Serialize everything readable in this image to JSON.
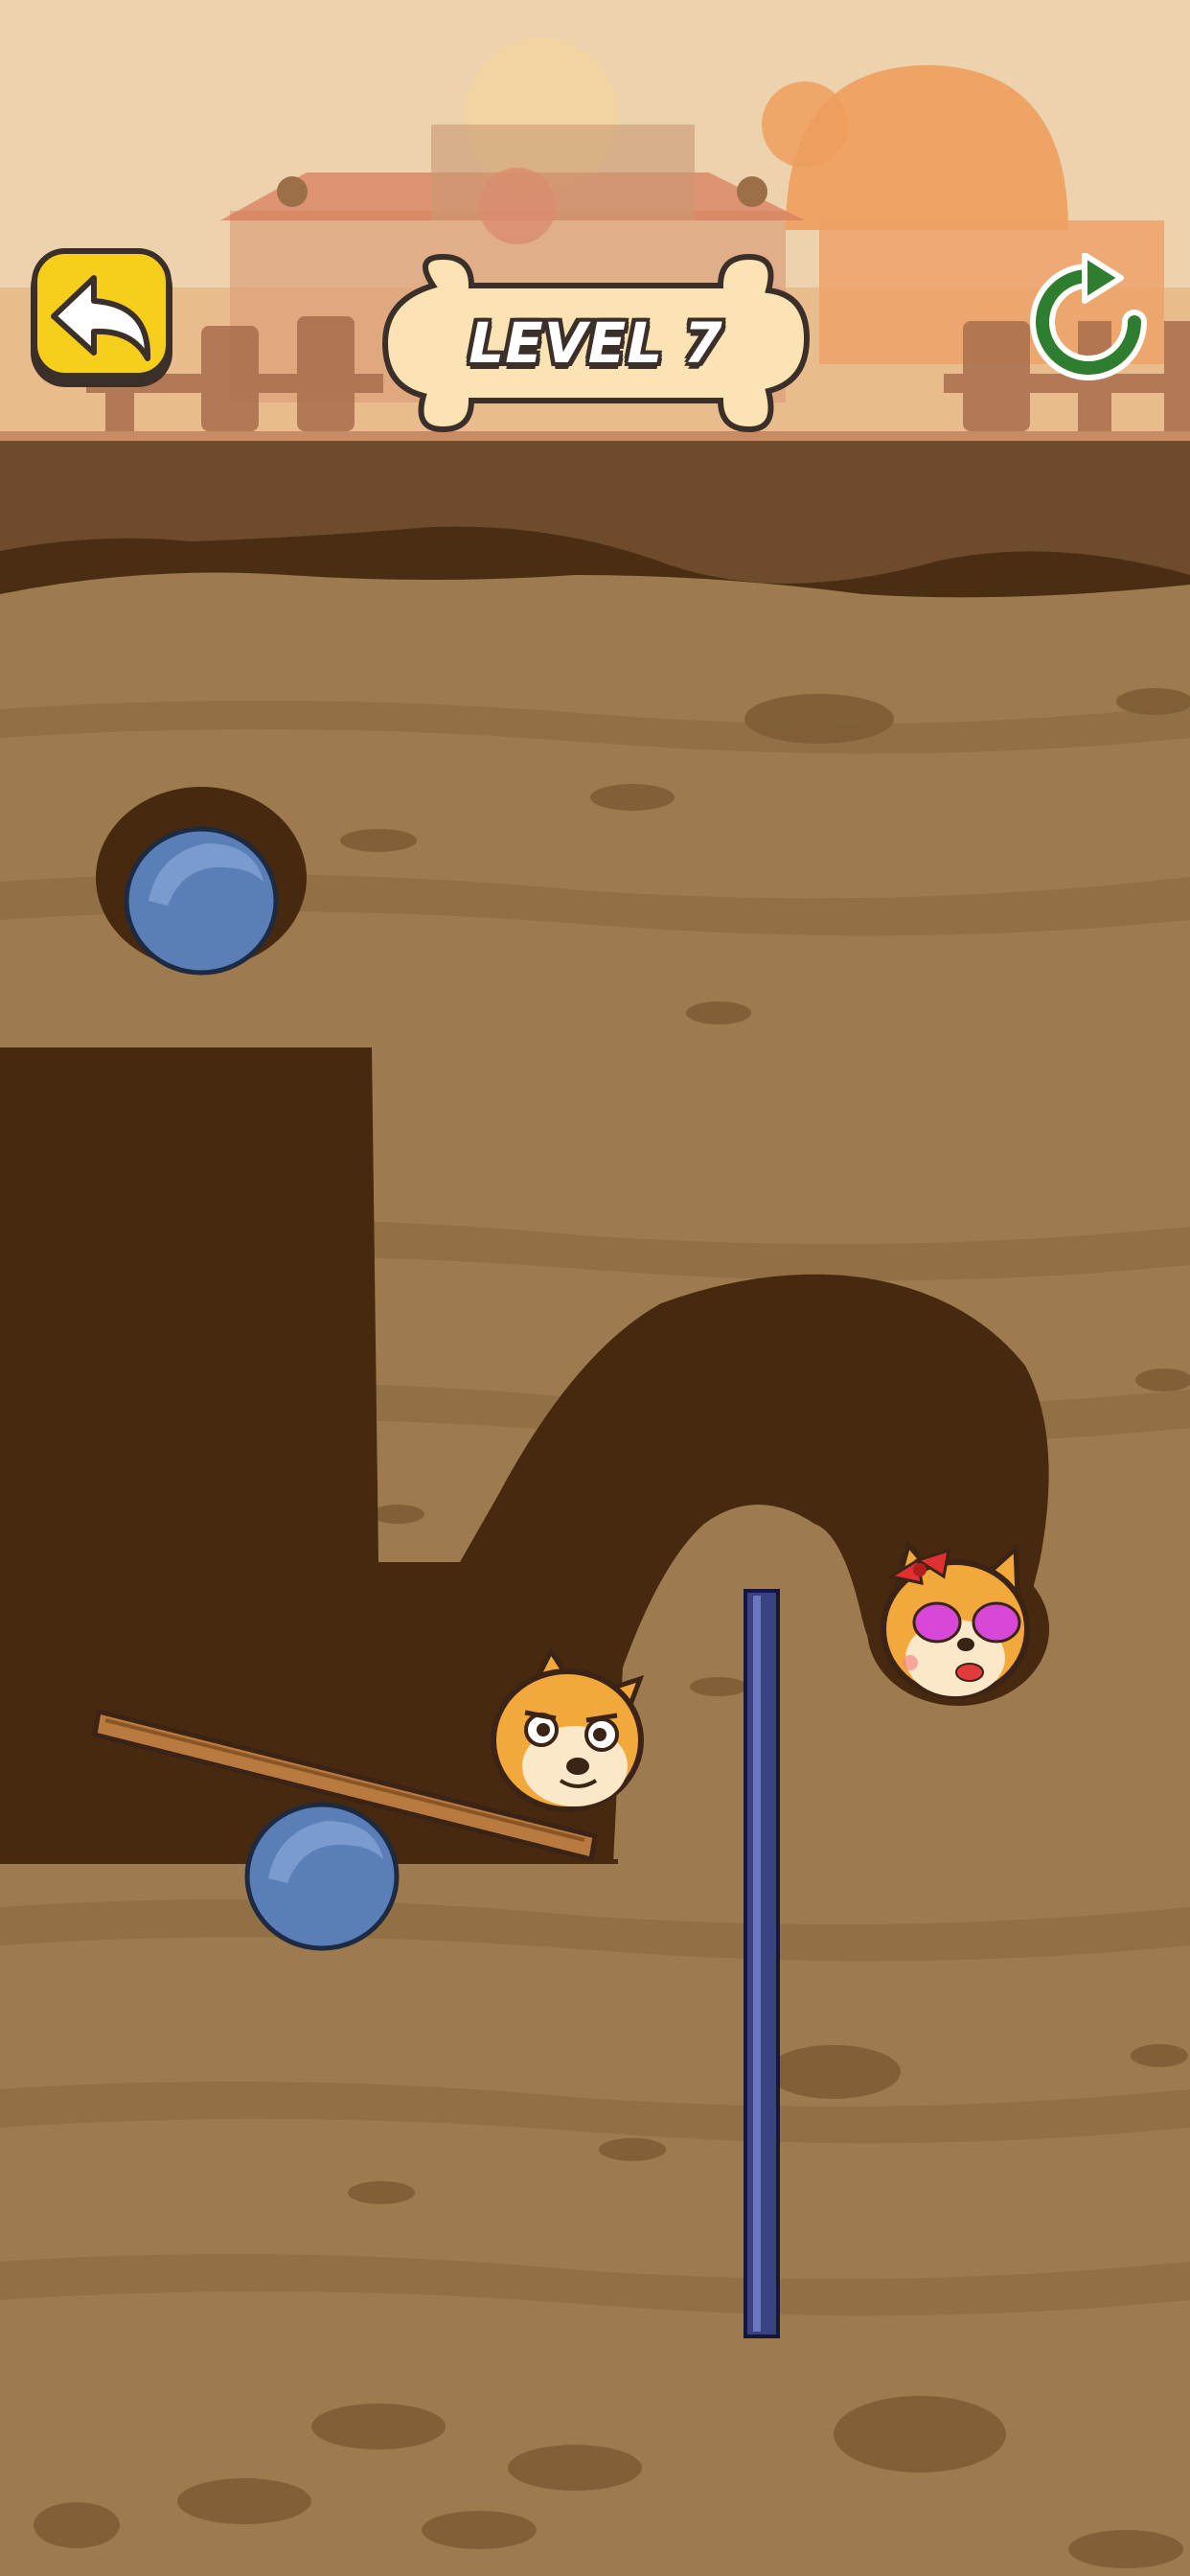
{
  "hud": {
    "level_label": "LEVEL 7",
    "back_icon": "undo-arrow-icon",
    "refresh_icon": "refresh-icon"
  },
  "scene": {
    "characters": [
      {
        "role": "dog-player",
        "name": "dog"
      },
      {
        "role": "girl-dog",
        "name": "girlfriend-dog"
      }
    ],
    "objects": [
      "boulder",
      "boulder",
      "wooden-plank",
      "metal-pin"
    ]
  },
  "colors": {
    "sky": "#ecd3ae",
    "dirt": "#9d7b4e",
    "dirt_dark_band": "#8a6a40",
    "tunnel": "#46290f",
    "surface": "#6e4b2c",
    "button_yellow": "#f7cf1b",
    "refresh_green": "#2f7d2f",
    "bone": "#fbe3b3",
    "boulder": "#5a7fb8",
    "pin": "#3a4282"
  }
}
